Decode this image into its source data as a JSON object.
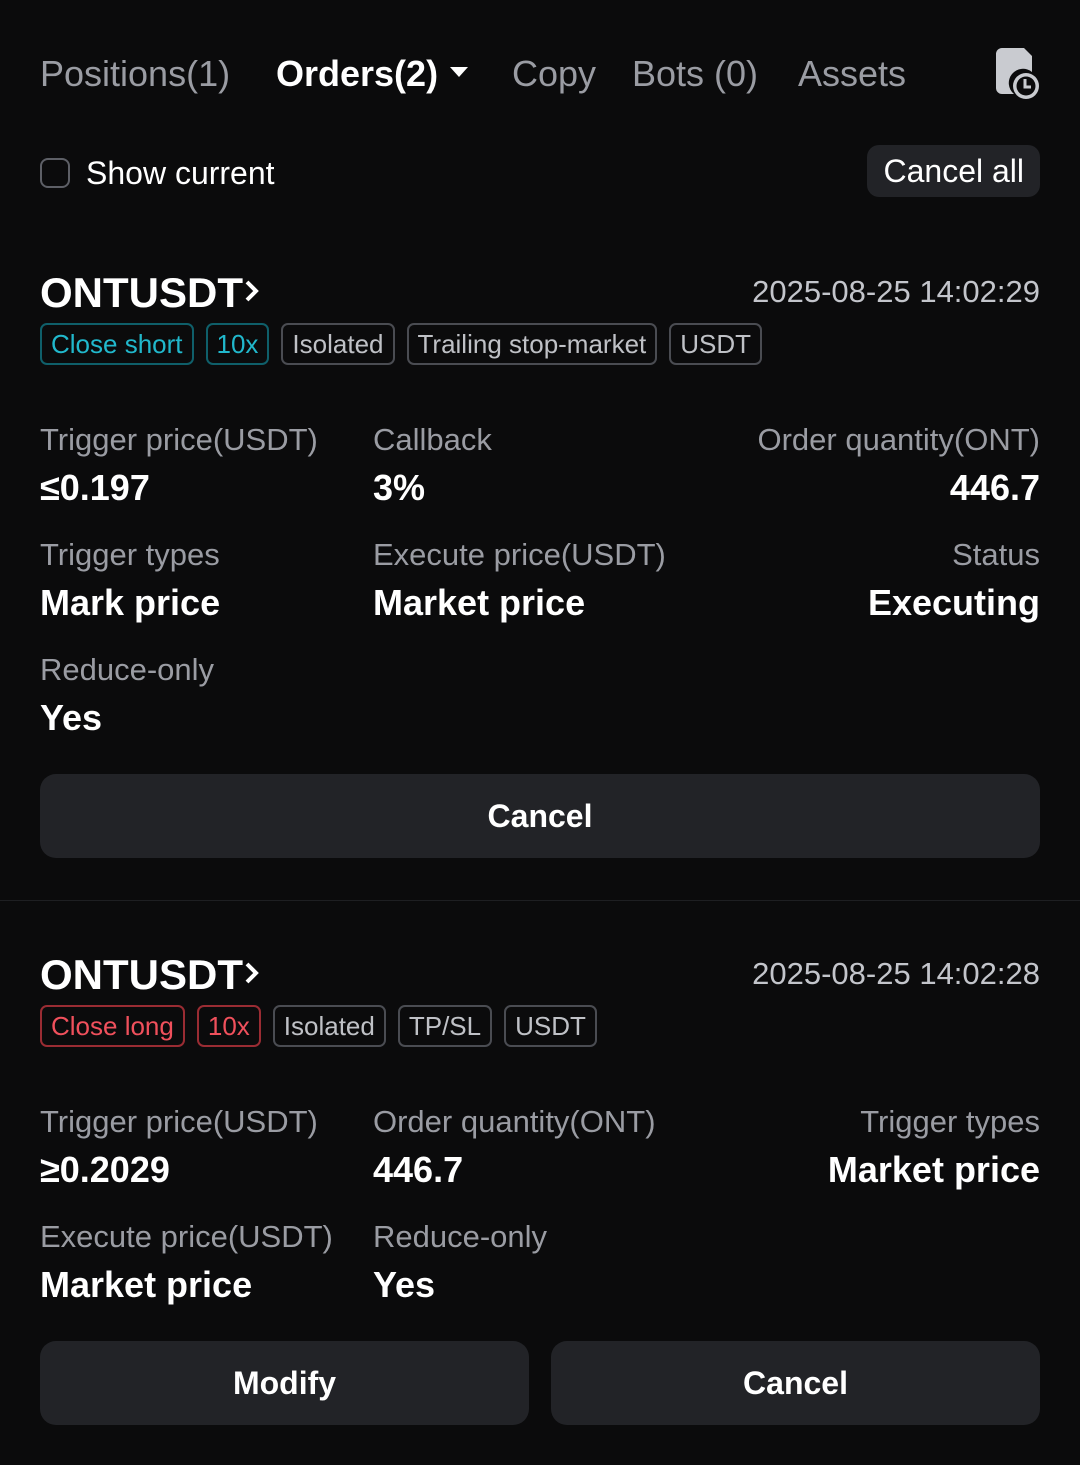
{
  "tabs": {
    "positions": "Positions(1)",
    "orders": "Orders(2)",
    "copy": "Copy",
    "bots": "Bots (0)",
    "assets": "Assets"
  },
  "filter": {
    "show_current_label": "Show current",
    "show_current_checked": false,
    "cancel_all_label": "Cancel all"
  },
  "orders": [
    {
      "symbol": "ONTUSDT",
      "timestamp": "2025-08-25 14:02:29",
      "tags": [
        "Close short",
        "10x",
        "Isolated",
        "Trailing stop-market",
        "USDT"
      ],
      "fields": {
        "trigger_price_label": "Trigger price(USDT)",
        "trigger_price_value": "≤0.197",
        "callback_label": "Callback",
        "callback_value": "3%",
        "order_qty_label": "Order quantity(ONT)",
        "order_qty_value": "446.7",
        "trigger_types_label": "Trigger types",
        "trigger_types_value": "Mark price",
        "execute_price_label": "Execute price(USDT)",
        "execute_price_value": "Market price",
        "status_label": "Status",
        "status_value": "Executing",
        "reduce_only_label": "Reduce-only",
        "reduce_only_value": "Yes"
      },
      "cancel_label": "Cancel"
    },
    {
      "symbol": "ONTUSDT",
      "timestamp": "2025-08-25 14:02:28",
      "tags": [
        "Close long",
        "10x",
        "Isolated",
        "TP/SL",
        "USDT"
      ],
      "fields": {
        "trigger_price_label": "Trigger price(USDT)",
        "trigger_price_value": "≥0.2029",
        "order_qty_label": "Order quantity(ONT)",
        "order_qty_value": "446.7",
        "trigger_types_label": "Trigger types",
        "trigger_types_value": "Market price",
        "execute_price_label": "Execute price(USDT)",
        "execute_price_value": "Market price",
        "reduce_only_label": "Reduce-only",
        "reduce_only_value": "Yes"
      },
      "modify_label": "Modify",
      "cancel_label": "Cancel"
    }
  ],
  "colors": {
    "background": "#0b0b0c",
    "button_bg": "#222327",
    "close_short": "#21b8cc",
    "close_long": "#f0505c",
    "muted_text": "#9a9ca3"
  }
}
